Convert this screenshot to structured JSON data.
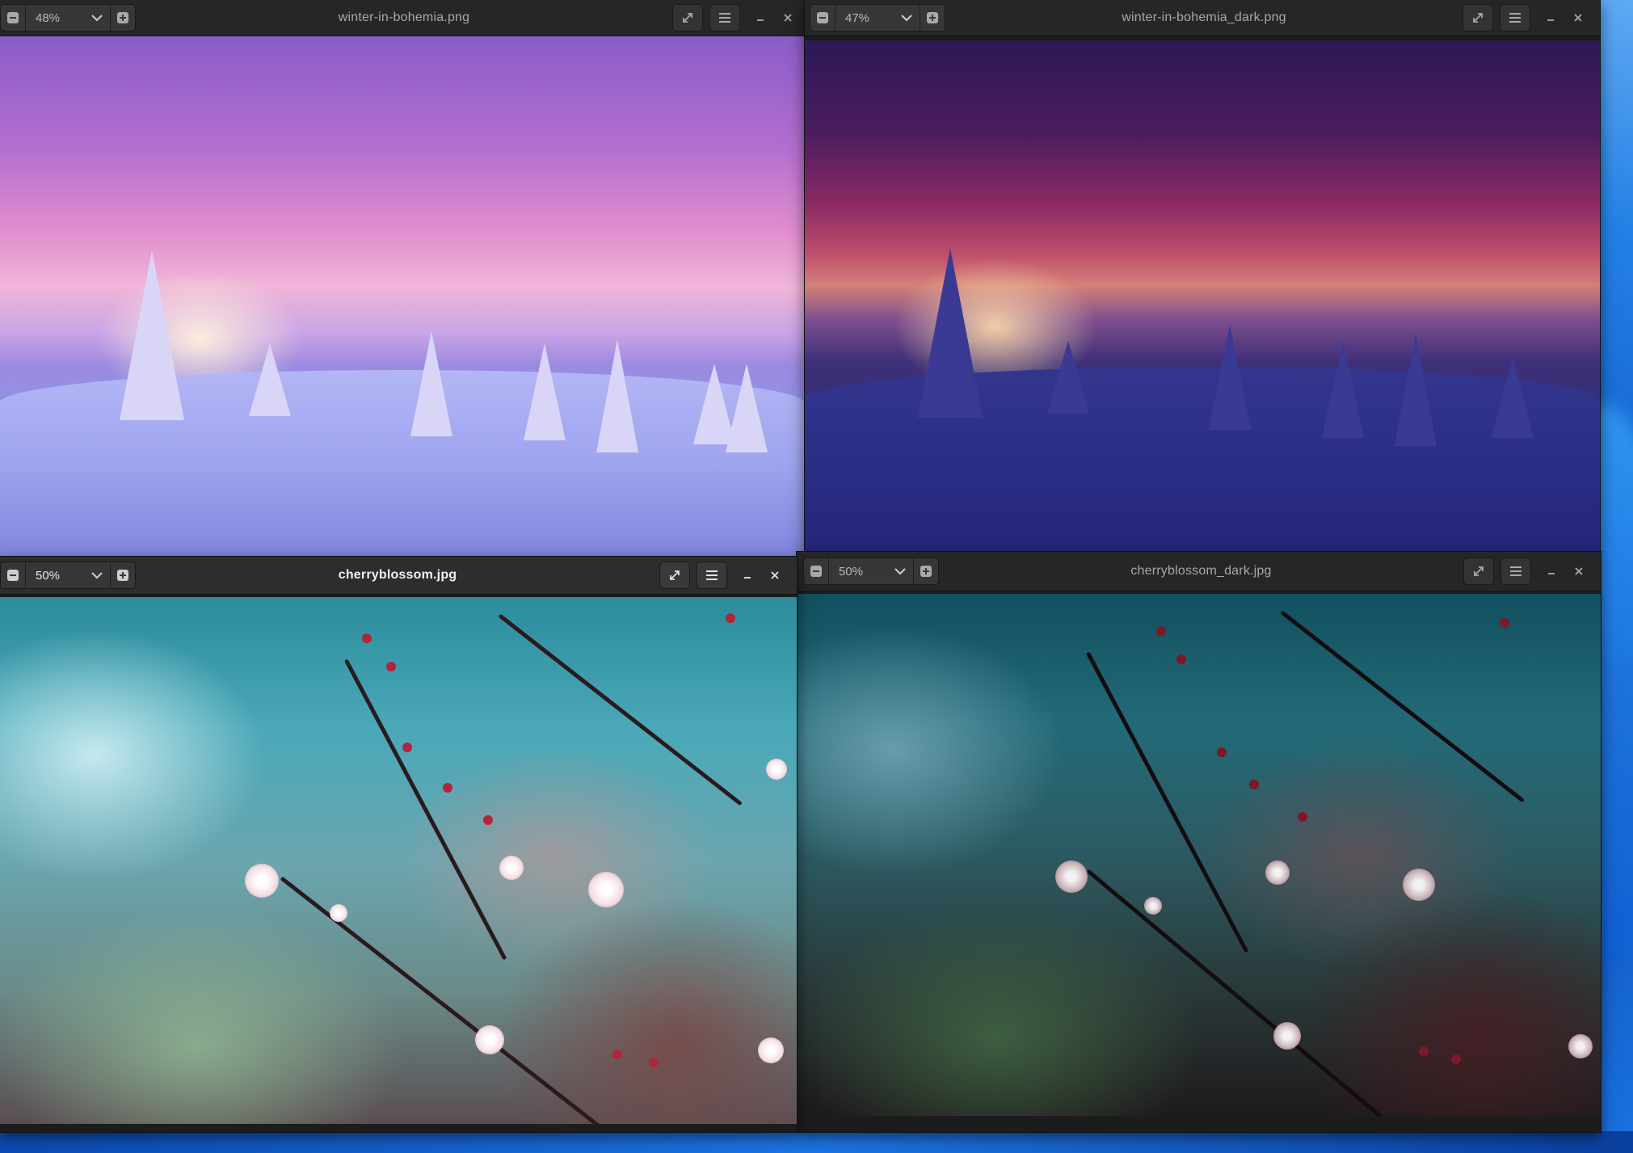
{
  "windows": [
    {
      "id": "winter",
      "title": "winter-in-bohemia.png",
      "zoom": "48%",
      "active": false
    },
    {
      "id": "winter-dark",
      "title": "winter-in-bohemia_dark.png",
      "zoom": "47%",
      "active": false
    },
    {
      "id": "cherry",
      "title": "cherryblossom.jpg",
      "zoom": "50%",
      "active": true
    },
    {
      "id": "cherry-dark",
      "title": "cherryblossom_dark.jpg",
      "zoom": "50%",
      "active": false
    }
  ],
  "icons": {
    "zoom_out": "minus-square-icon",
    "zoom_in": "plus-square-icon",
    "zoom_menu": "chevron-down-icon",
    "fullscreen": "expand-arrows-icon",
    "menu": "hamburger-menu-icon",
    "minimize": "minimize-icon",
    "close": "close-icon"
  },
  "colors": {
    "titlebar_active": "#2d2d2d",
    "titlebar_inactive": "#262626",
    "title_text_active": "#f0f0f0",
    "title_text_inactive": "#a8a8a8"
  }
}
